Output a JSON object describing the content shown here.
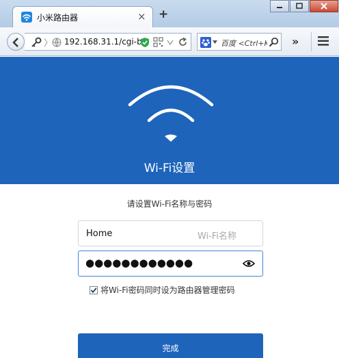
{
  "browser": {
    "tab_title": "小米路由器",
    "tab_close": "×",
    "new_tab": "+",
    "url": "192.168.31.1/cgi-b",
    "search_placeholder": "百度 <Ctrl+K>",
    "overflow": "»"
  },
  "page": {
    "header_title": "Wi-Fi设置",
    "prompt": "请设置Wi-Fi名称与密码",
    "ssid_value": "Home",
    "ssid_placeholder": "Wi-Fi名称",
    "password_masked": "●●●●●●●●●●●●",
    "sync_admin_label": "将Wi-Fi密码同时设为路由器管理密码",
    "sync_admin_checked": true,
    "submit_label": "完成"
  },
  "colors": {
    "brand_blue": "#1e64bb",
    "focus_border": "#3e86d6"
  }
}
